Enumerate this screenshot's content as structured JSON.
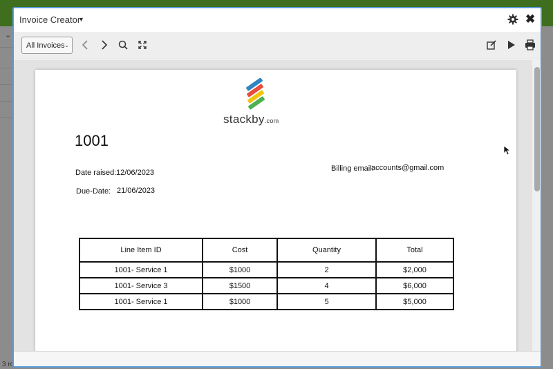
{
  "background": {
    "rows_text": "3 ro",
    "bottom_text": "All Invoices"
  },
  "modal": {
    "title": "Invoice Creator",
    "icons": [
      "gear-icon",
      "close-icon"
    ]
  },
  "toolbar": {
    "view_select": "All Invoices",
    "icons": [
      "chevron-left-icon",
      "chevron-right-icon",
      "search-icon",
      "expand-icon",
      "edit-icon",
      "play-icon",
      "print-icon"
    ]
  },
  "invoice": {
    "brand": "stackby",
    "brand_suffix": ".com",
    "logo_colors": [
      "#2e86c1",
      "#e74c3c",
      "#f1c40f",
      "#4caf50"
    ],
    "number": "1001",
    "date_raised_label": "Date raised:",
    "date_raised": "12/06/2023",
    "due_date_label": "Due-Date:",
    "due_date": "21/06/2023",
    "billing_email_label": "Billing email:",
    "billing_email": "accounts@gmail.com",
    "table": {
      "headers": [
        "Line Item ID",
        "Cost",
        "Quantity",
        "Total"
      ],
      "rows": [
        [
          "1001- Service 1",
          "$1000",
          "2",
          "$2,000"
        ],
        [
          "1001- Service 3",
          "$1500",
          "4",
          "$6,000"
        ],
        [
          "1001- Service 1",
          "$1000",
          "5",
          "$5,000"
        ]
      ]
    }
  }
}
